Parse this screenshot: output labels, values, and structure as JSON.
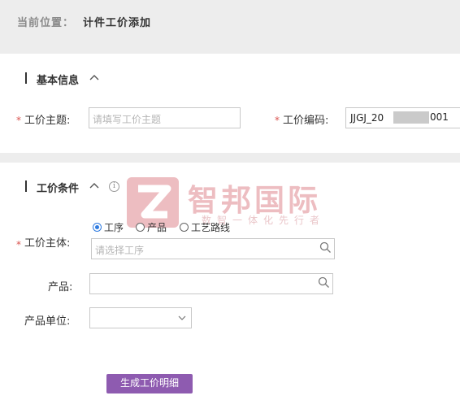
{
  "breadcrumb": {
    "label": "当前位置：",
    "value": "计件工价添加"
  },
  "basic_section": {
    "title": "基本信息"
  },
  "condition_section": {
    "title": "工价条件"
  },
  "fields": {
    "subject": {
      "label": "工价主题:",
      "placeholder": "请填写工价主题"
    },
    "code": {
      "label": "工价编码:",
      "value_prefix": "JJGJ_20",
      "value_suffix": "001"
    },
    "entity": {
      "label": "工价主体:",
      "options": [
        "工序",
        "产品",
        "工艺路线"
      ],
      "selected": "工序",
      "placeholder": "请选择工序"
    },
    "product": {
      "label": "产品:",
      "value": ""
    },
    "unit": {
      "label": "产品单位:",
      "value": ""
    }
  },
  "actions": {
    "generate": "生成工价明细"
  },
  "watermark": {
    "brand": "智邦国际",
    "tagline": "数智一体化先行者"
  },
  "colors": {
    "accent": "#8e5bb0",
    "required": "#d9534f",
    "radio_selected": "#2f7be0",
    "watermark": "#e8a7ad"
  }
}
